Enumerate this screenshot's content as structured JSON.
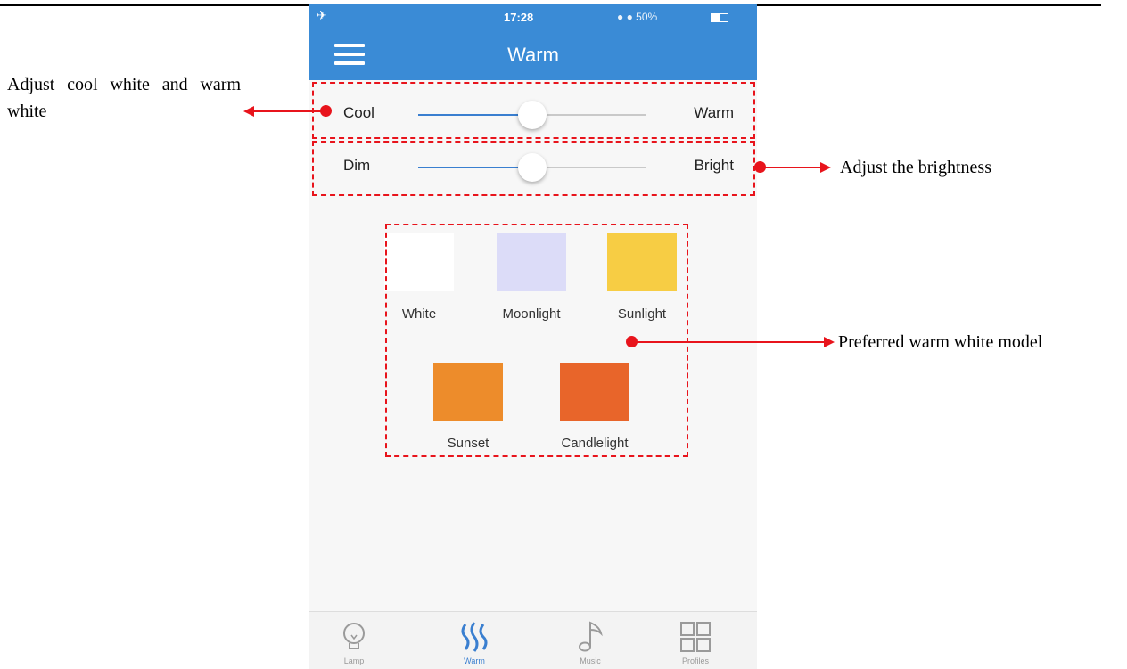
{
  "status_bar": {
    "time": "17:28",
    "indicators": "● ●  50%",
    "airplane": "✈",
    "battery_level": 0.5
  },
  "nav": {
    "title": "Warm"
  },
  "sliders": {
    "temperature": {
      "left_label": "Cool",
      "right_label": "Warm",
      "value": 0.5
    },
    "brightness": {
      "left_label": "Dim",
      "right_label": "Bright",
      "value": 0.5
    }
  },
  "presets": [
    {
      "label": "White",
      "color": "#ffffff"
    },
    {
      "label": "Moonlight",
      "color": "#dcdcf8"
    },
    {
      "label": "Sunlight",
      "color": "#f7cd44"
    },
    {
      "label": "Sunset",
      "color": "#ed8c2b"
    },
    {
      "label": "Candlelight",
      "color": "#e8652a"
    }
  ],
  "tabs": [
    {
      "label": "Lamp",
      "icon": "lightbulb-icon"
    },
    {
      "label": "Warm",
      "icon": "warm-waves-icon",
      "active": true
    },
    {
      "label": "Music",
      "icon": "music-note-icon"
    },
    {
      "label": "Profiles",
      "icon": "grid-icon"
    }
  ],
  "annotations": {
    "temperature": "Adjust cool white and warm white",
    "brightness": "Adjust the brightness",
    "presets": "Preferred warm white model"
  },
  "colors": {
    "accent": "#3a8bd6",
    "annotation": "#e8141c"
  }
}
